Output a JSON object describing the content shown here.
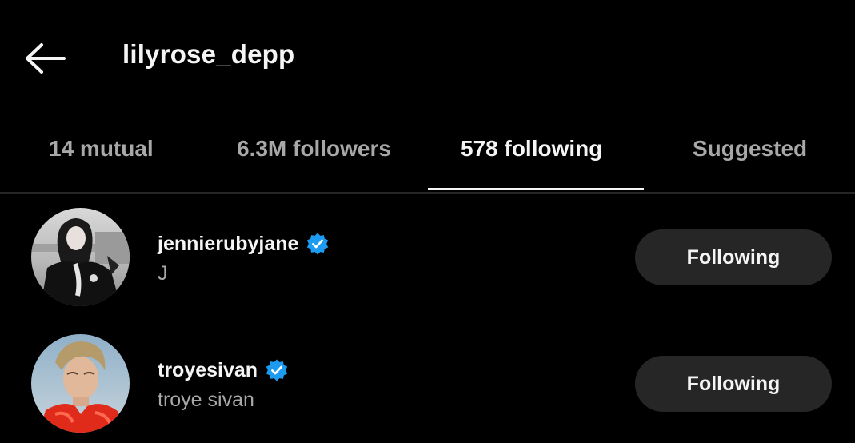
{
  "header": {
    "title": "lilyrose_depp"
  },
  "tabs": [
    {
      "label": "14 mutual",
      "active": false
    },
    {
      "label": "6.3M followers",
      "active": false
    },
    {
      "label": "578 following",
      "active": true
    },
    {
      "label": "Suggested",
      "active": false
    }
  ],
  "users": [
    {
      "username": "jennierubyjane",
      "fullname": "J",
      "verified": true,
      "button_label": "Following"
    },
    {
      "username": "troyesivan",
      "fullname": "troye sivan",
      "verified": true,
      "button_label": "Following"
    }
  ],
  "colors": {
    "background": "#000000",
    "primary_text": "#f5f5f5",
    "secondary_text": "#a8a8a8",
    "button_bg": "#262626",
    "verified_blue": "#1d9bf0"
  },
  "icons": {
    "back": "arrow-left-icon",
    "verified": "verified-badge-icon"
  }
}
